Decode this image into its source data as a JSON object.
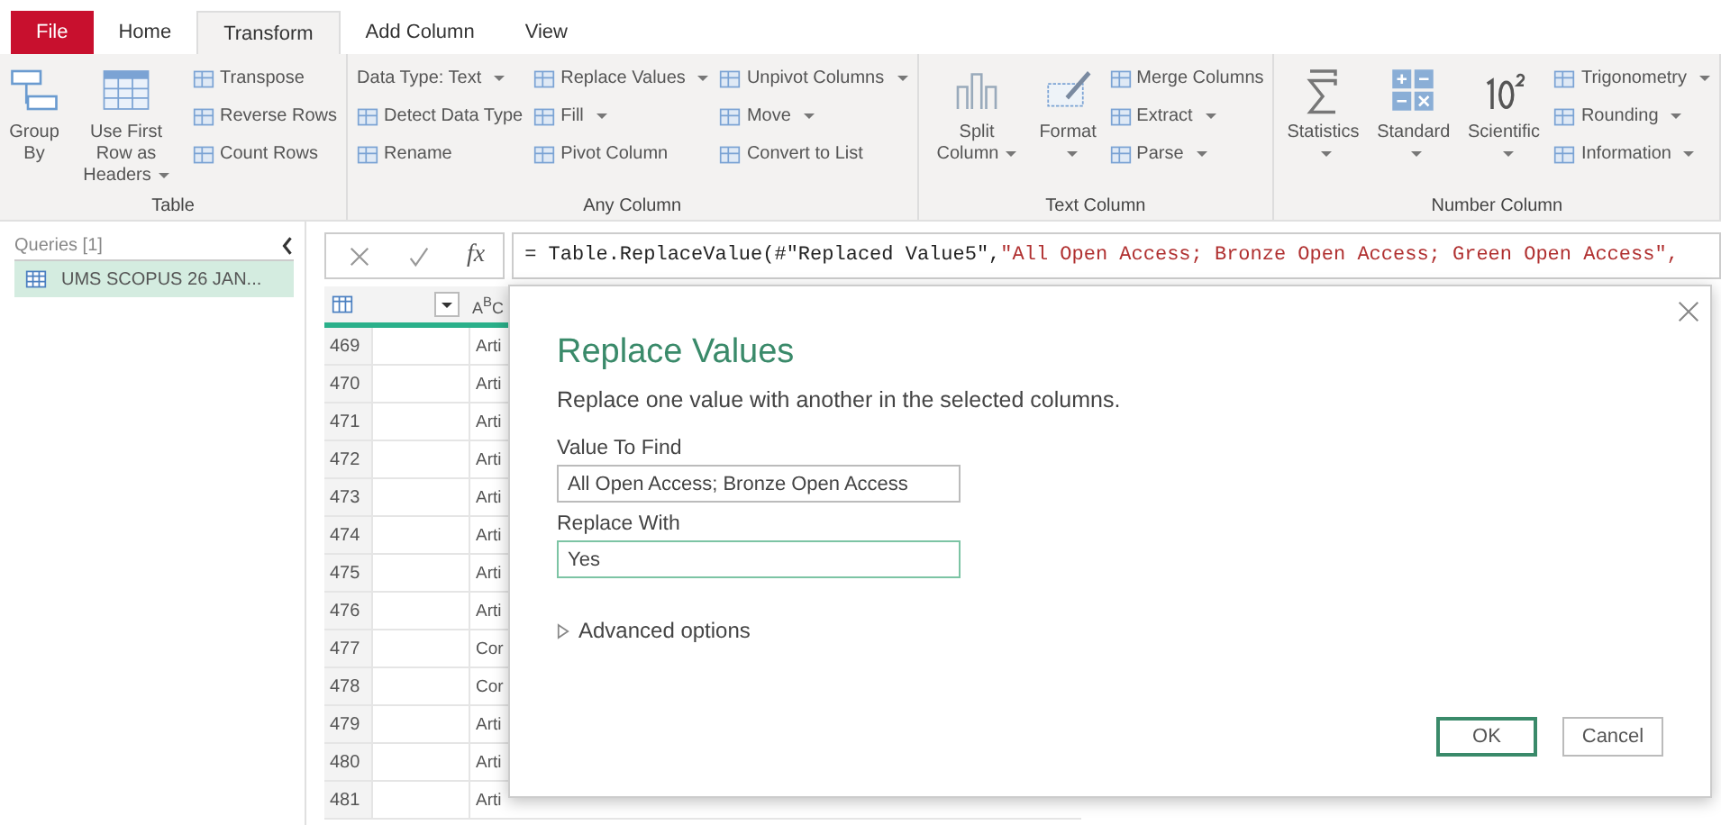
{
  "tabs": [
    {
      "label": "File",
      "kind": "file",
      "selected": false
    },
    {
      "label": "Home",
      "kind": "tab",
      "selected": false
    },
    {
      "label": "Transform",
      "kind": "tab",
      "selected": true
    },
    {
      "label": "Add Column",
      "kind": "tab",
      "selected": false
    },
    {
      "label": "View",
      "kind": "tab",
      "selected": false
    }
  ],
  "ribbon": {
    "groups": [
      {
        "label": "Table",
        "items": [
          {
            "kind": "large",
            "label": "Group By",
            "dropdown": false
          },
          {
            "kind": "large",
            "label": "Use First Row as Headers",
            "dropdown": true
          },
          {
            "kind": "stack",
            "buttons": [
              {
                "label": "Transpose",
                "dropdown": false
              },
              {
                "label": "Reverse Rows",
                "dropdown": false
              },
              {
                "label": "Count Rows",
                "dropdown": false
              }
            ]
          }
        ]
      },
      {
        "label": "Any Column",
        "items": [
          {
            "kind": "stack",
            "buttons": [
              {
                "label": "Data Type: Text",
                "dropdown": true,
                "noicon": true
              },
              {
                "label": "Detect Data Type",
                "dropdown": false
              },
              {
                "label": "Rename",
                "dropdown": false
              }
            ]
          },
          {
            "kind": "stack",
            "buttons": [
              {
                "label": "Replace Values",
                "dropdown": true
              },
              {
                "label": "Fill",
                "dropdown": true
              },
              {
                "label": "Pivot Column",
                "dropdown": false
              }
            ]
          },
          {
            "kind": "stack",
            "buttons": [
              {
                "label": "Unpivot Columns",
                "dropdown": true
              },
              {
                "label": "Move",
                "dropdown": true
              },
              {
                "label": "Convert to List",
                "dropdown": false
              }
            ]
          }
        ]
      },
      {
        "label": "Text Column",
        "items": [
          {
            "kind": "large",
            "label": "Split Column",
            "dropdown": true
          },
          {
            "kind": "large",
            "label": "Format",
            "dropdown": true
          },
          {
            "kind": "stack",
            "buttons": [
              {
                "label": "Merge Columns",
                "dropdown": false
              },
              {
                "label": "Extract",
                "dropdown": true
              },
              {
                "label": "Parse",
                "dropdown": true
              }
            ]
          }
        ]
      },
      {
        "label": "Number Column",
        "items": [
          {
            "kind": "large",
            "label": "Statistics",
            "dropdown": true
          },
          {
            "kind": "large",
            "label": "Standard",
            "dropdown": true
          },
          {
            "kind": "large",
            "label": "Scientific",
            "dropdown": true
          },
          {
            "kind": "stack",
            "buttons": [
              {
                "label": "Trigonometry",
                "dropdown": true
              },
              {
                "label": "Rounding",
                "dropdown": true
              },
              {
                "label": "Information",
                "dropdown": true
              }
            ]
          }
        ]
      }
    ]
  },
  "queries": {
    "title": "Queries [1]",
    "items": [
      {
        "label": "UMS SCOPUS 26 JAN...",
        "selected": true
      }
    ]
  },
  "formula_bar": {
    "fx": "fx",
    "code": "= Table.ReplaceValue(#\"Replaced Value5\",",
    "string": "\"All Open Access; Bronze Open Access; Green Open Access\","
  },
  "grid": {
    "type_label": "A$^{B}$C",
    "rows": [
      {
        "number": "469",
        "column_2": "Arti"
      },
      {
        "number": "470",
        "column_2": "Arti"
      },
      {
        "number": "471",
        "column_2": "Arti"
      },
      {
        "number": "472",
        "column_2": "Arti"
      },
      {
        "number": "473",
        "column_2": "Arti"
      },
      {
        "number": "474",
        "column_2": "Arti"
      },
      {
        "number": "475",
        "column_2": "Arti"
      },
      {
        "number": "476",
        "column_2": "Arti"
      },
      {
        "number": "477",
        "column_2": "Cor"
      },
      {
        "number": "478",
        "column_2": "Cor"
      },
      {
        "number": "479",
        "column_2": "Arti"
      },
      {
        "number": "480",
        "column_2": "Arti"
      },
      {
        "number": "481",
        "column_2": "Arti"
      }
    ]
  },
  "dialog": {
    "title": "Replace Values",
    "description": "Replace one value with another in the selected columns.",
    "fields": [
      {
        "label": "Value To Find",
        "value": "All Open Access; Bronze Open Access",
        "focused": false
      },
      {
        "label": "Replace With",
        "value": "Yes",
        "focused": true
      }
    ],
    "advanced": {
      "label": "Advanced options",
      "expanded": false
    },
    "buttons": [
      {
        "label": "OK",
        "kind": "primary"
      },
      {
        "label": "Cancel",
        "kind": "secondary"
      }
    ]
  }
}
